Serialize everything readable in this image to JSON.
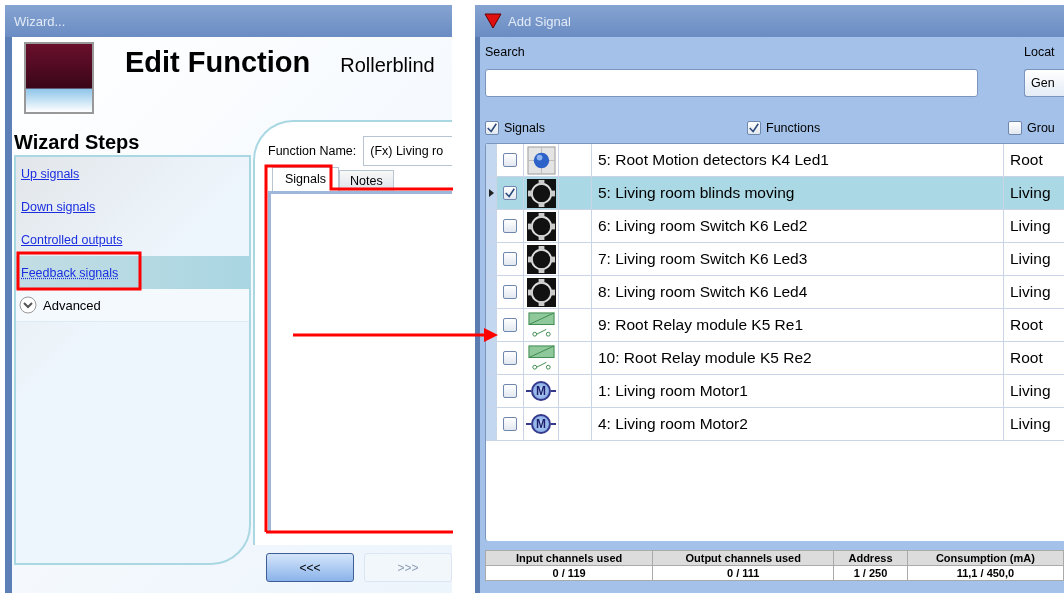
{
  "wizard": {
    "title": "Wizard...",
    "heading": "Edit Function",
    "function_type": "Rollerblind",
    "steps_title": "Wizard Steps",
    "steps": [
      {
        "label": "Up signals",
        "selected": false
      },
      {
        "label": "Down signals",
        "selected": false
      },
      {
        "label": "Controlled outputs",
        "selected": false
      },
      {
        "label": "Feedback signals",
        "selected": true
      }
    ],
    "advanced": {
      "label": "Advanced",
      "expanded": false
    },
    "function_name_label": "Function Name:",
    "function_name_value": "(Fx) Living ro",
    "tabs": [
      {
        "label": "Signals",
        "selected": true
      },
      {
        "label": "Notes",
        "selected": false
      }
    ],
    "buttons": [
      {
        "label": "<<<",
        "disabled": false
      },
      {
        "label": ">>>",
        "disabled": true
      }
    ]
  },
  "add_signal": {
    "title": "Add Signal",
    "search_label": "Search",
    "location_label": "Locat",
    "location_value": "Gen",
    "filters": [
      {
        "label": "Signals",
        "checked": true
      },
      {
        "label": "Functions",
        "checked": true
      },
      {
        "label": "Grou",
        "checked": false
      }
    ],
    "rows": [
      {
        "kind": "led",
        "name": "5: Root Motion detectors K4 Led1",
        "location": "Root",
        "checked": false,
        "selected": false
      },
      {
        "kind": "switch",
        "name": "5: Living room blinds moving",
        "location": "Living",
        "checked": true,
        "selected": true
      },
      {
        "kind": "switch",
        "name": "6: Living room Switch K6 Led2",
        "location": "Living",
        "checked": false,
        "selected": false
      },
      {
        "kind": "switch",
        "name": "7: Living room Switch K6 Led3",
        "location": "Living",
        "checked": false,
        "selected": false
      },
      {
        "kind": "switch",
        "name": "8: Living room Switch K6 Led4",
        "location": "Living",
        "checked": false,
        "selected": false
      },
      {
        "kind": "relay",
        "name": "9: Root Relay module K5 Re1",
        "location": "Root",
        "checked": false,
        "selected": false
      },
      {
        "kind": "relay",
        "name": "10: Root Relay module K5 Re2",
        "location": "Root",
        "checked": false,
        "selected": false
      },
      {
        "kind": "motor",
        "icon_label": "M",
        "name": "1: Living room Motor1",
        "location": "Living",
        "checked": false,
        "selected": false
      },
      {
        "kind": "motor",
        "icon_label": "M",
        "name": "4: Living room Motor2",
        "location": "Living",
        "checked": false,
        "selected": false
      }
    ],
    "status": {
      "columns": [
        "Input channels used",
        "Output channels used",
        "Address",
        "Consumption (mA)"
      ],
      "values": [
        "0 / 119",
        "0 / 111",
        "1 / 250",
        "11,1 / 450,0"
      ]
    }
  }
}
